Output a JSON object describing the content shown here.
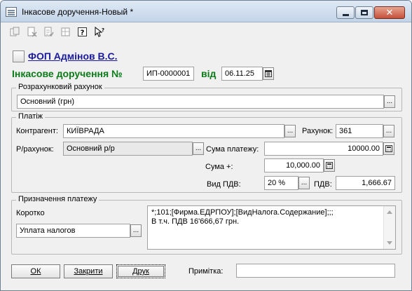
{
  "window": {
    "title": "Інкасове доручення-Новый *"
  },
  "toolbar": {
    "icons": [
      "copy-doc-icon",
      "delete-doc-icon",
      "post-doc-icon",
      "unpost-doc-icon",
      "help-icon",
      "whats-this-icon"
    ],
    "help_glyph": "?"
  },
  "header": {
    "organization": "ФОП Адмінов В.С.",
    "doc_title": "Інкасове доручення №",
    "doc_number": "ИП-0000001",
    "from_label": "від",
    "doc_date": "06.11.25"
  },
  "account_group": {
    "label": "Розрахунковий рахунок",
    "value": "Основний (грн)"
  },
  "payment_group": {
    "label": "Платіж",
    "counterparty_label": "Контрагент:",
    "counterparty_value": "КИЇВРАДА",
    "invoice_label": "Рахунок:",
    "invoice_value": "361",
    "account_label": "Р/рахунок:",
    "account_value": "Основний р/р",
    "sum_label": "Сума платежу:",
    "sum_value": "10000.00",
    "sum_plus_label": "Сума +:",
    "sum_plus_value": "10,000.00",
    "vat_type_label": "Вид ПДВ:",
    "vat_type_value": "20 %",
    "vat_label": "ПДВ:",
    "vat_value": "1,666.67"
  },
  "purpose_group": {
    "label": "Призначення платежу",
    "short_label": "Коротко",
    "short_value": "Уплата налогов",
    "text_lines": [
      "*;101;[Фирма.ЕДРПОУ];[ВидНалога.Содержание];;;",
      "В т.ч. ПДВ 16'666,67 грн."
    ]
  },
  "footer": {
    "ok_label": "ОК",
    "close_label": "Закрити",
    "print_label": "Друк",
    "note_label": "Примітка:",
    "note_value": ""
  },
  "ellipsis": "...",
  "colors": {
    "title_green": "#0b7a18",
    "link_blue": "#1a1aa0",
    "window_bg": "#f0f0f0"
  }
}
